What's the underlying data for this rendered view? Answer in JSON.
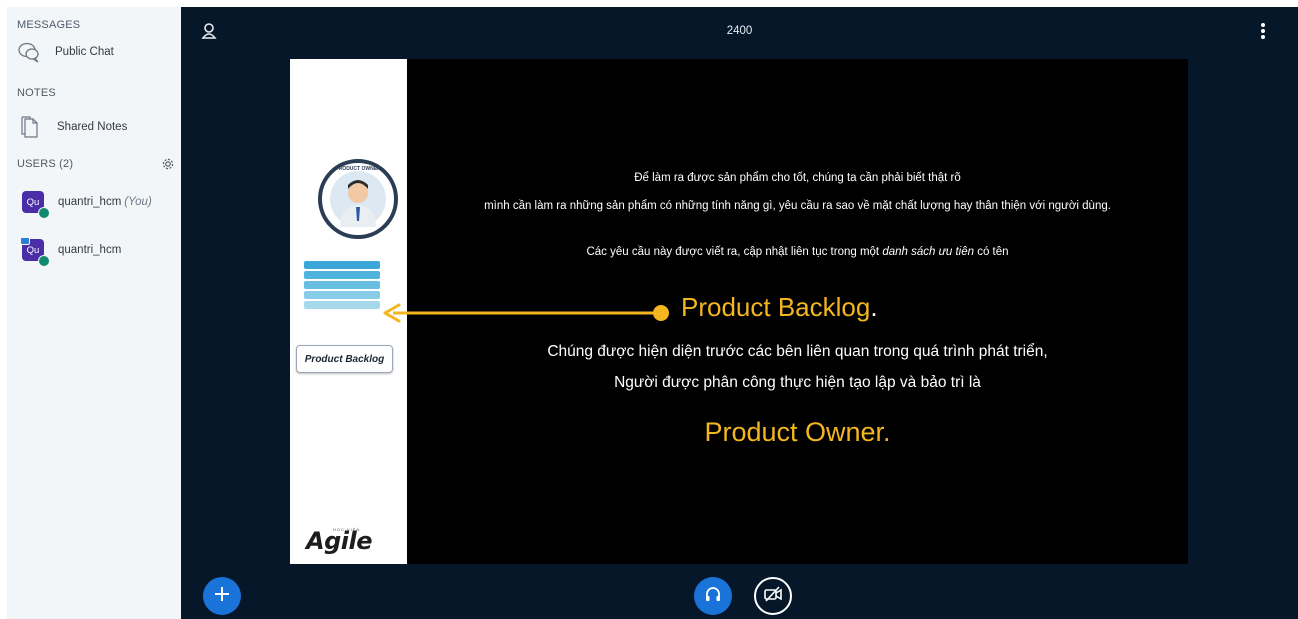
{
  "sidebar": {
    "messages_title": "MESSAGES",
    "public_chat": "Public Chat",
    "notes_title": "NOTES",
    "shared_notes": "Shared Notes",
    "users_title": "USERS (2)",
    "users": [
      {
        "initials": "Qu",
        "name": "quantri_hcm",
        "you_label": "(You)",
        "avatar_color": "#4a2ea8"
      },
      {
        "initials": "Qu",
        "name": "quantri_hcm",
        "avatar_color": "#4a2ea8"
      }
    ]
  },
  "header": {
    "title": "2400"
  },
  "slide": {
    "left_panel": {
      "badge_text": "PRODUCT OWNER",
      "box_label": "Product Backlog",
      "logo_small": "HỌC VIỆN",
      "logo_text": "Agile"
    },
    "line1": "Để làm ra được sản phẩm cho tốt, chúng ta cần phải biết thật rõ",
    "line2": "mình cần làm ra những sản phẩm có những tính năng gì, yêu cầu ra sao về mặt chất lượng hay thân thiện với người dùng.",
    "line3_pre": "Các yêu cầu này được viết ra, cập nhật liên tục trong một ",
    "line3_italic": "danh sách ưu tiên",
    "line3_post": " có tên",
    "highlight1": "Product Backlog",
    "highlight1_dot": ".",
    "line4": "Chúng được hiện diện trước các bên liên quan trong quá trình phát triển,",
    "line5": "Người được phân công thực hiện tạo lập và bảo trì là",
    "highlight2": "Product Owner."
  },
  "colors": {
    "accent": "#1a73d9",
    "highlight": "#f3b61f",
    "main_bg": "#06172a"
  }
}
